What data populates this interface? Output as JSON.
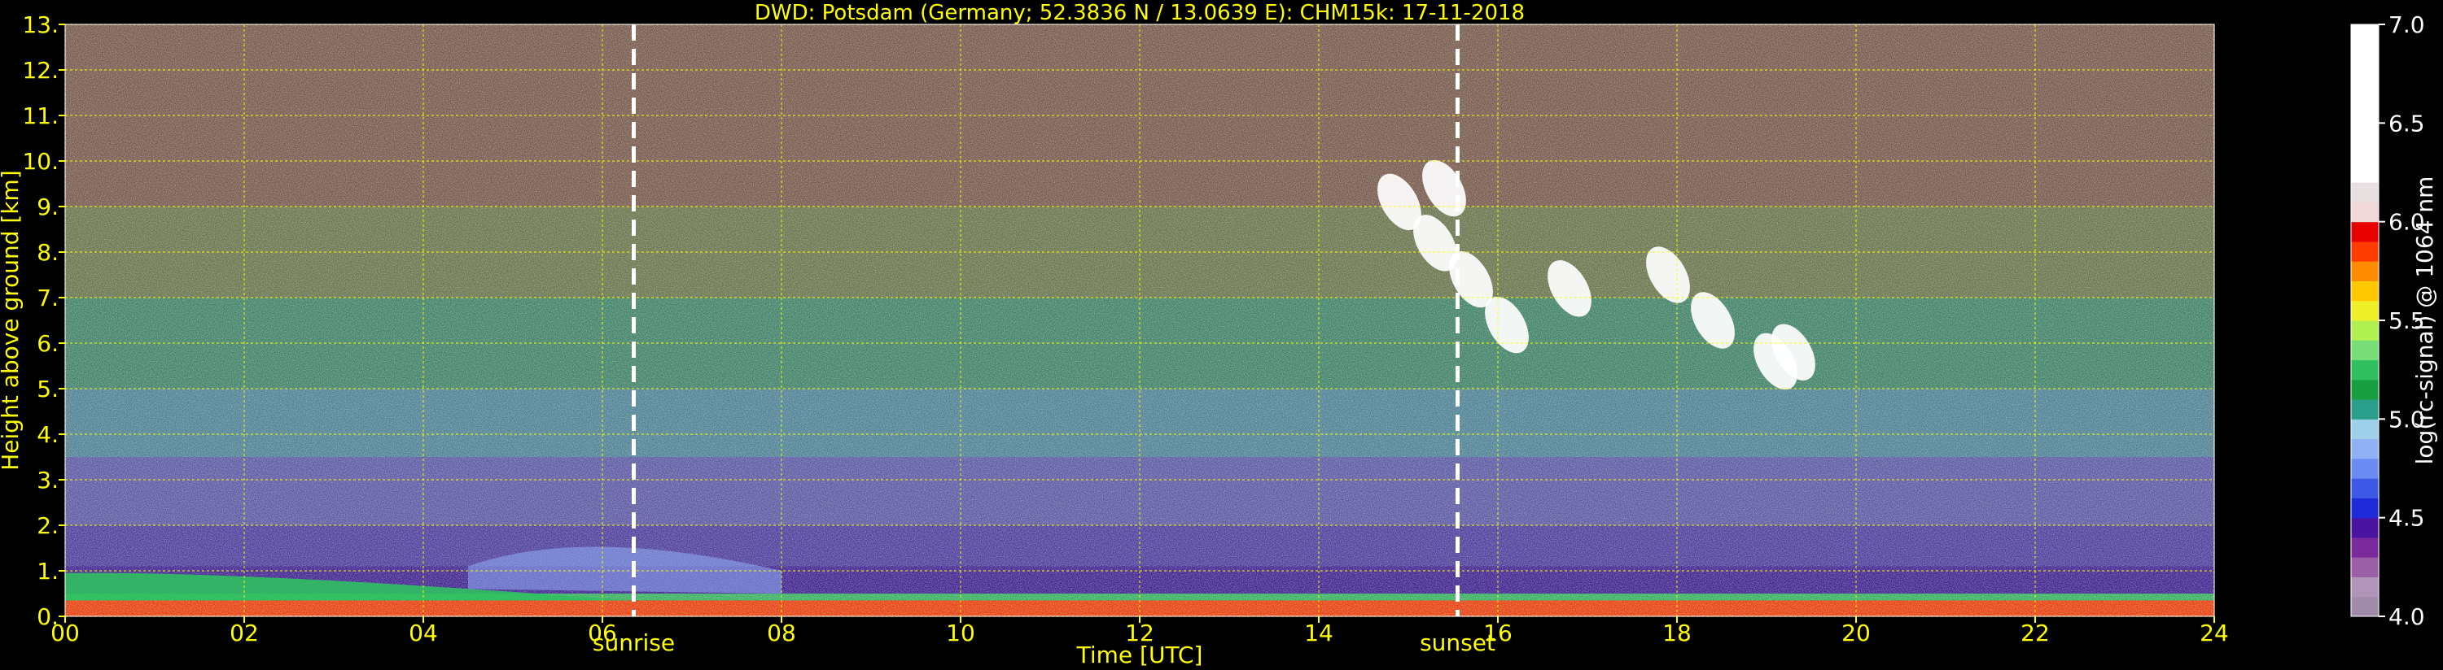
{
  "chart_data": {
    "type": "heatmap",
    "title": "DWD: Potsdam (Germany; 52.3836 N / 13.0639 E):    CHM15k: 17-11-2018",
    "xlabel": "Time [UTC]",
    "ylabel": "Height above ground [km]",
    "xlim": [
      0,
      24
    ],
    "ylim": [
      0,
      13
    ],
    "x_ticks": [
      {
        "value": 0,
        "label": "00"
      },
      {
        "value": 2,
        "label": "02"
      },
      {
        "value": 4,
        "label": "04"
      },
      {
        "value": 6,
        "label": "06"
      },
      {
        "value": 8,
        "label": "08"
      },
      {
        "value": 10,
        "label": "10"
      },
      {
        "value": 12,
        "label": "12"
      },
      {
        "value": 14,
        "label": "14"
      },
      {
        "value": 16,
        "label": "16"
      },
      {
        "value": 18,
        "label": "18"
      },
      {
        "value": 20,
        "label": "20"
      },
      {
        "value": 22,
        "label": "22"
      },
      {
        "value": 24,
        "label": "24"
      }
    ],
    "y_ticks": [
      {
        "value": 0,
        "label": "0."
      },
      {
        "value": 1,
        "label": "1."
      },
      {
        "value": 2,
        "label": "2."
      },
      {
        "value": 3,
        "label": "3."
      },
      {
        "value": 4,
        "label": "4."
      },
      {
        "value": 5,
        "label": "5."
      },
      {
        "value": 6,
        "label": "6."
      },
      {
        "value": 7,
        "label": "7."
      },
      {
        "value": 8,
        "label": "8."
      },
      {
        "value": 9,
        "label": "9."
      },
      {
        "value": 10,
        "label": "10."
      },
      {
        "value": 11,
        "label": "11."
      },
      {
        "value": 12,
        "label": "12."
      },
      {
        "value": 13,
        "label": "13."
      }
    ],
    "grid": true,
    "grid_color": "#ffff00",
    "events": [
      {
        "label": "sunrise",
        "time": 6.35
      },
      {
        "label": "sunset",
        "time": 15.55
      }
    ],
    "colorbar": {
      "label": "log(rc-signal) @ 1064 nm",
      "range": [
        4.0,
        7.0
      ],
      "ticks": [
        {
          "value": 4.0,
          "label": "4.0"
        },
        {
          "value": 4.5,
          "label": "4.5"
        },
        {
          "value": 5.0,
          "label": "5.0"
        },
        {
          "value": 5.5,
          "label": "5.5"
        },
        {
          "value": 6.0,
          "label": "6.0"
        },
        {
          "value": 6.5,
          "label": "6.5"
        },
        {
          "value": 7.0,
          "label": "7.0"
        }
      ],
      "bands": [
        {
          "from": 4.0,
          "to": 4.1,
          "color": "#a08ca8"
        },
        {
          "from": 4.1,
          "to": 4.2,
          "color": "#b095b8"
        },
        {
          "from": 4.2,
          "to": 4.3,
          "color": "#9b5fa8"
        },
        {
          "from": 4.3,
          "to": 4.4,
          "color": "#7a2a9a"
        },
        {
          "from": 4.4,
          "to": 4.5,
          "color": "#4a14a0"
        },
        {
          "from": 4.5,
          "to": 4.6,
          "color": "#1e2ad8"
        },
        {
          "from": 4.6,
          "to": 4.7,
          "color": "#3c5ae6"
        },
        {
          "from": 4.7,
          "to": 4.8,
          "color": "#6a8cf2"
        },
        {
          "from": 4.8,
          "to": 4.9,
          "color": "#8fb0f5"
        },
        {
          "from": 4.9,
          "to": 5.0,
          "color": "#9ed0ea"
        },
        {
          "from": 5.0,
          "to": 5.1,
          "color": "#2aa08a"
        },
        {
          "from": 5.1,
          "to": 5.2,
          "color": "#18a040"
        },
        {
          "from": 5.2,
          "to": 5.3,
          "color": "#30c060"
        },
        {
          "from": 5.3,
          "to": 5.4,
          "color": "#78dc78"
        },
        {
          "from": 5.4,
          "to": 5.5,
          "color": "#b0f050"
        },
        {
          "from": 5.5,
          "to": 5.6,
          "color": "#f0f028"
        },
        {
          "from": 5.6,
          "to": 5.7,
          "color": "#ffc800"
        },
        {
          "from": 5.7,
          "to": 5.8,
          "color": "#ff8c00"
        },
        {
          "from": 5.8,
          "to": 5.9,
          "color": "#ff3c00"
        },
        {
          "from": 5.9,
          "to": 6.0,
          "color": "#e60000"
        },
        {
          "from": 6.0,
          "to": 6.1,
          "color": "#f0d8d8"
        },
        {
          "from": 6.1,
          "to": 6.2,
          "color": "#e8e0e0"
        },
        {
          "from": 6.2,
          "to": 7.0,
          "color": "#ffffff"
        }
      ]
    },
    "field": {
      "background_layers": [
        {
          "from": 0.0,
          "to": 0.35,
          "color": "#ff3c00"
        },
        {
          "from": 0.35,
          "to": 0.5,
          "color": "#30c060"
        },
        {
          "from": 0.5,
          "to": 1.1,
          "color": "#3a1a9a"
        },
        {
          "from": 1.1,
          "to": 2.0,
          "color": "#4a3aa8"
        },
        {
          "from": 2.0,
          "to": 3.5,
          "color": "#5a5ab0"
        },
        {
          "from": 3.5,
          "to": 5.0,
          "color": "#4a8aa0"
        },
        {
          "from": 5.0,
          "to": 7.0,
          "color": "#3a8a6a"
        },
        {
          "from": 7.0,
          "to": 9.0,
          "color": "#6a7a4a"
        },
        {
          "from": 9.0,
          "to": 13.0,
          "color": "#7a5a4a"
        }
      ],
      "features": [
        {
          "kind": "morning-boundary-layer",
          "color": "#30c060",
          "t_start": 0.0,
          "t_end": 6.3,
          "h_top_start": 0.95,
          "h_top_end": 0.35
        },
        {
          "kind": "aerosol-plume",
          "color": "#8fb0f5",
          "t_start": 4.5,
          "t_end": 8.0,
          "h_peak": 1.7
        },
        {
          "kind": "cirrus-cloud",
          "color": "#ffffff",
          "points": [
            [
              14.9,
              9.1
            ],
            [
              15.3,
              8.2
            ],
            [
              15.7,
              7.4
            ],
            [
              16.1,
              6.4
            ],
            [
              15.4,
              9.4
            ],
            [
              16.8,
              7.2
            ],
            [
              17.9,
              7.5
            ],
            [
              18.4,
              6.5
            ],
            [
              19.1,
              5.6
            ],
            [
              19.3,
              5.8
            ]
          ]
        }
      ]
    }
  }
}
